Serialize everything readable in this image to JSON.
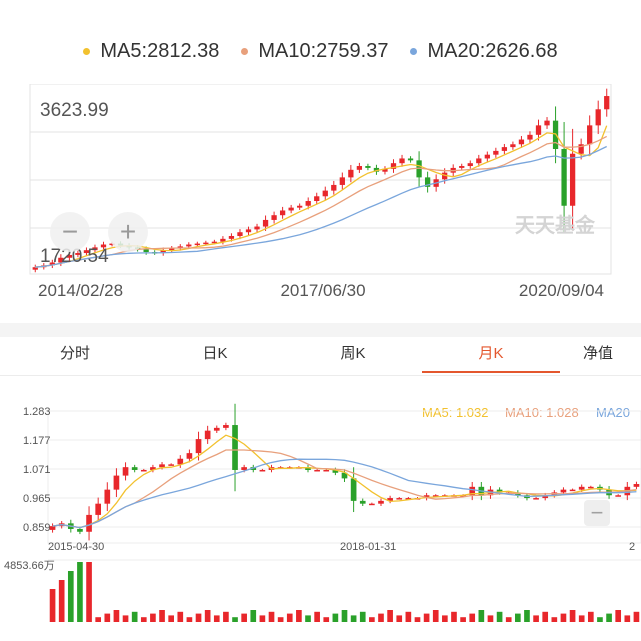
{
  "top_legend": [
    {
      "label": "MA5:2812.38",
      "color": "#f2c12e"
    },
    {
      "label": "MA10:2759.37",
      "color": "#e8a07c"
    },
    {
      "label": "MA20:2626.68",
      "color": "#7aa6dc"
    }
  ],
  "top_chart": {
    "max_label": "3623.99",
    "min_label": "1720.54",
    "dates": [
      "2014/02/28",
      "2017/06/30",
      "2020/09/04"
    ],
    "watermark": "天天基金",
    "zoom_out_symbol": "−",
    "zoom_in_symbol": "+"
  },
  "tabs": [
    {
      "label": "分时",
      "active": false
    },
    {
      "label": "日K",
      "active": false
    },
    {
      "label": "周K",
      "active": false
    },
    {
      "label": "月K",
      "active": true
    },
    {
      "label": "净值",
      "active": false
    }
  ],
  "bottom_chart": {
    "legend": [
      {
        "label": "MA5: 1.032",
        "color": "#f2c12e"
      },
      {
        "label": "MA10: 1.028",
        "color": "#e8a07c"
      },
      {
        "label": "MA20",
        "color": "#7aa6dc"
      }
    ],
    "y_ticks": [
      "1.283",
      "1.177",
      "1.071",
      "0.965",
      "0.859"
    ],
    "dates": [
      "2015-04-30",
      "2018-01-31",
      "2"
    ],
    "volume_label": "4853.66万",
    "zoom_out_symbol": "−"
  },
  "colors": {
    "up": "#e8272b",
    "down": "#2aa12a",
    "ma5": "#f2c12e",
    "ma10": "#e8a07c",
    "ma20": "#7aa6dc",
    "active_tab": "#e4572e"
  },
  "chart_data": [
    {
      "type": "candlestick",
      "ylim": [
        1720.54,
        3623.99
      ],
      "x_range": [
        "2014/02/28",
        "2020/09/04"
      ],
      "approx_close_series": [
        1750,
        1770,
        1800,
        1850,
        1880,
        1900,
        1930,
        1960,
        1990,
        2000,
        1980,
        1960,
        1940,
        1910,
        1900,
        1930,
        1950,
        1970,
        1990,
        2000,
        2010,
        2020,
        2050,
        2080,
        2120,
        2150,
        2180,
        2250,
        2300,
        2350,
        2380,
        2400,
        2450,
        2500,
        2560,
        2620,
        2700,
        2780,
        2820,
        2800,
        2760,
        2790,
        2850,
        2900,
        2880,
        2700,
        2600,
        2680,
        2750,
        2800,
        2820,
        2850,
        2900,
        2940,
        2980,
        3020,
        3050,
        3100,
        3150,
        3250,
        3300,
        3000,
        2400,
        2950,
        3050,
        3250,
        3420,
        3560
      ],
      "series": [
        {
          "name": "MA5",
          "last": 2812.38
        },
        {
          "name": "MA10",
          "last": 2759.37
        },
        {
          "name": "MA20",
          "last": 2626.68
        }
      ]
    },
    {
      "type": "candlestick",
      "ylim": [
        0.83,
        1.3
      ],
      "y_ticks": [
        1.283,
        1.177,
        1.071,
        0.965,
        0.859
      ],
      "approx_close_series": [
        0.89,
        0.9,
        0.88,
        0.87,
        0.93,
        0.97,
        1.02,
        1.07,
        1.1,
        1.09,
        1.09,
        1.1,
        1.11,
        1.11,
        1.13,
        1.15,
        1.2,
        1.23,
        1.24,
        1.25,
        1.09,
        1.1,
        1.09,
        1.09,
        1.1,
        1.1,
        1.1,
        1.1,
        1.09,
        1.09,
        1.09,
        1.08,
        1.06,
        0.98,
        0.97,
        0.97,
        0.98,
        0.99,
        0.99,
        0.99,
        0.99,
        1.0,
        1.0,
        1.0,
        1.0,
        1.0,
        1.03,
        1.0,
        1.02,
        1.01,
        1.01,
        1.0,
        0.99,
        0.99,
        1.0,
        1.01,
        1.02,
        1.02,
        1.03,
        1.03,
        1.02,
        1.0,
        1.0,
        1.03,
        1.04
      ],
      "series": [
        {
          "name": "MA5",
          "last": 1.032
        },
        {
          "name": "MA10",
          "last": 1.028
        },
        {
          "name": "MA20"
        }
      ],
      "volume_max": "4853.66万"
    }
  ]
}
